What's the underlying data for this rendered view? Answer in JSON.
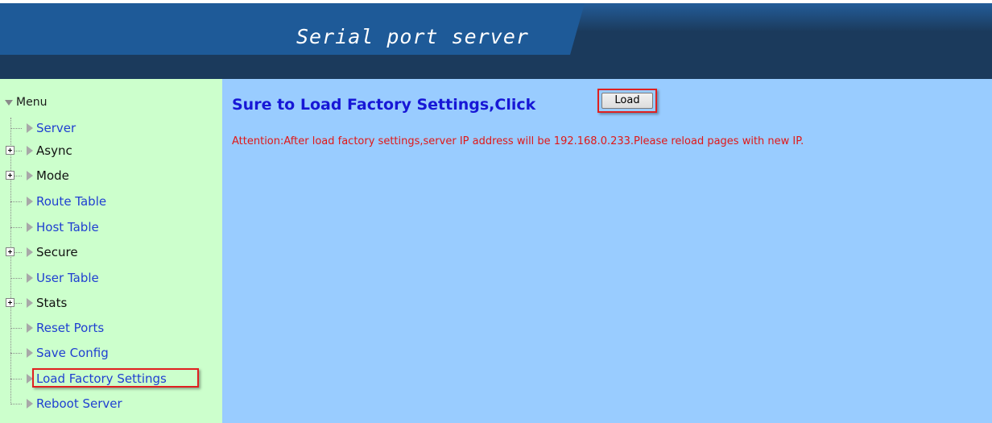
{
  "header": {
    "title": "Serial port server"
  },
  "sidebar": {
    "root_label": "Menu",
    "items": [
      {
        "label": "Server",
        "type": "link",
        "expandable": false
      },
      {
        "label": "Async",
        "type": "folder",
        "expandable": true
      },
      {
        "label": "Mode",
        "type": "folder",
        "expandable": true
      },
      {
        "label": "Route Table",
        "type": "link",
        "expandable": false
      },
      {
        "label": "Host Table",
        "type": "link",
        "expandable": false
      },
      {
        "label": "Secure",
        "type": "folder",
        "expandable": true
      },
      {
        "label": "User Table",
        "type": "link",
        "expandable": false
      },
      {
        "label": "Stats",
        "type": "folder",
        "expandable": true
      },
      {
        "label": "Reset Ports",
        "type": "link",
        "expandable": false
      },
      {
        "label": "Save Config",
        "type": "link",
        "expandable": false
      },
      {
        "label": "Load Factory Settings",
        "type": "link",
        "expandable": false,
        "highlighted": true
      },
      {
        "label": "Reboot Server",
        "type": "link",
        "expandable": false
      }
    ]
  },
  "main": {
    "heading": "Sure to Load Factory Settings,Click",
    "load_button_label": "Load",
    "attention": "Attention:After load factory settings,server IP address will be 192.168.0.233.Please reload pages with new IP."
  },
  "colors": {
    "banner": "#1e5a98",
    "banner_dark": "#1b3a5c",
    "sidebar_bg": "#ccffcc",
    "main_bg": "#99ccff",
    "heading": "#1717d6",
    "link": "#1f3fd1",
    "attention": "#e01818",
    "highlight": "#e02020"
  }
}
